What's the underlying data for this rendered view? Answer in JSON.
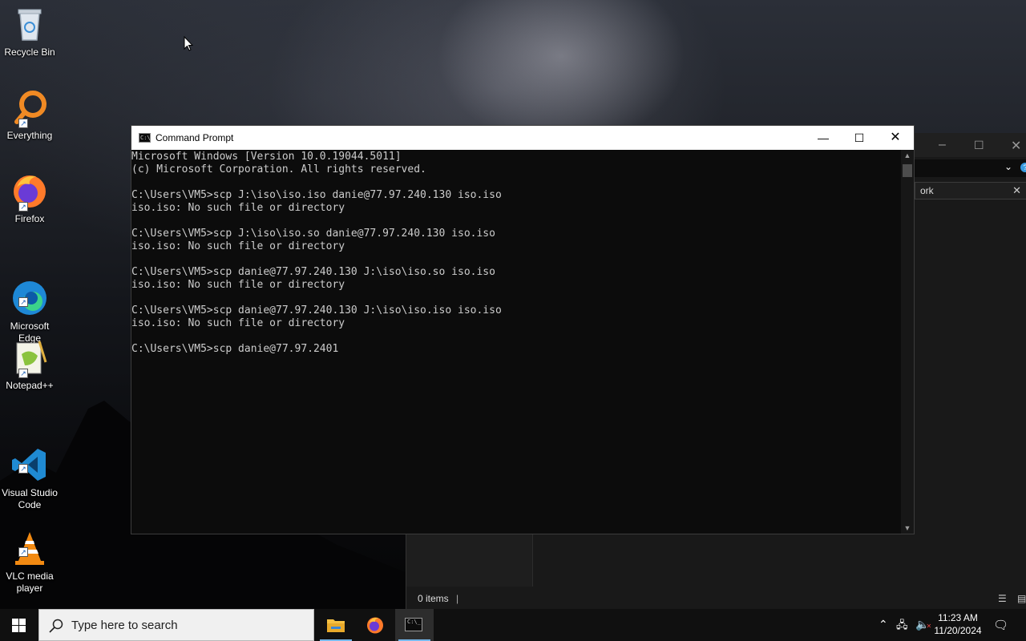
{
  "desktop": {
    "icons": [
      {
        "label": "Recycle Bin",
        "icon": "recycle-bin-icon"
      },
      {
        "label": "Everything",
        "icon": "everything-search-icon"
      },
      {
        "label": "Firefox",
        "icon": "firefox-icon"
      },
      {
        "label": "Microsoft\nEdge",
        "icon": "edge-icon"
      },
      {
        "label": "Notepad++",
        "icon": "notepad-plus-plus-icon"
      },
      {
        "label": "Visual Studio\nCode",
        "icon": "vscode-icon"
      },
      {
        "label": "VLC media\nplayer",
        "icon": "vlc-icon"
      }
    ]
  },
  "explorer": {
    "search_text": "ork",
    "status_items": "0 items"
  },
  "cmd": {
    "title": "Command Prompt",
    "output": "Microsoft Windows [Version 10.0.19044.5011]\n(c) Microsoft Corporation. All rights reserved.\n\nC:\\Users\\VM5>scp J:\\iso\\iso.iso danie@77.97.240.130 iso.iso\niso.iso: No such file or directory\n\nC:\\Users\\VM5>scp J:\\iso\\iso.so danie@77.97.240.130 iso.iso\niso.iso: No such file or directory\n\nC:\\Users\\VM5>scp danie@77.97.240.130 J:\\iso\\iso.so iso.iso\niso.iso: No such file or directory\n\nC:\\Users\\VM5>scp danie@77.97.240.130 J:\\iso\\iso.iso iso.iso\niso.iso: No such file or directory\n\nC:\\Users\\VM5>scp danie@77.97.2401"
  },
  "taskbar": {
    "search_placeholder": "Type here to search",
    "time": "11:23 AM",
    "date": "11/20/2024"
  },
  "colors": {
    "terminal_bg": "#0c0c0c",
    "terminal_fg": "#cccccc",
    "taskbar_bg": "#101010",
    "active_indicator": "#76b9ed"
  }
}
